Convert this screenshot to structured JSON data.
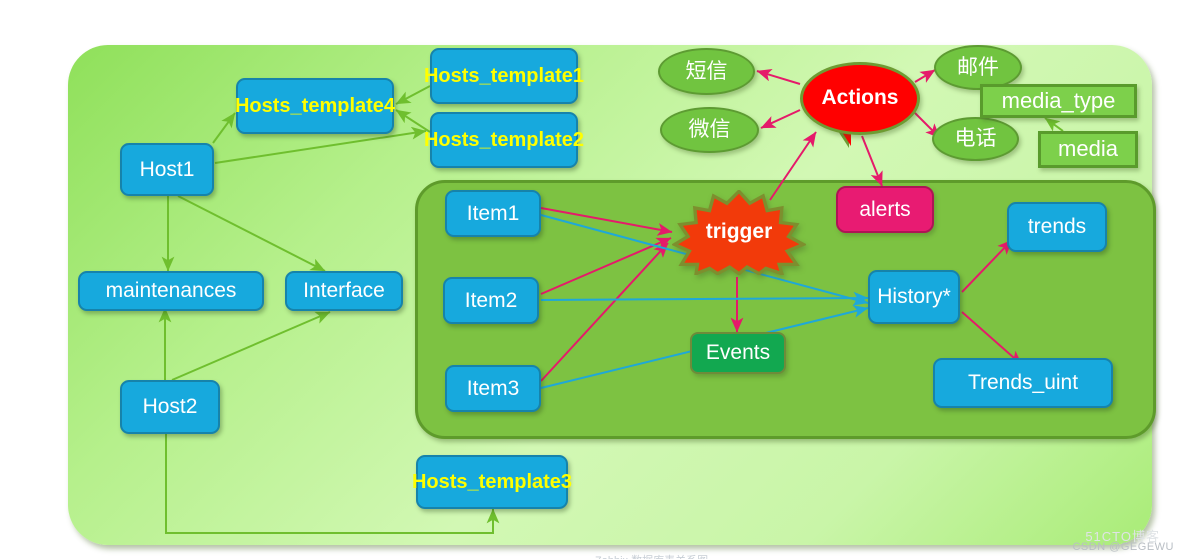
{
  "diagram": {
    "title": "Zabbix data model relationship diagram",
    "colors": {
      "blue_node": "#17a9dd",
      "blue_border": "#1683ab",
      "template_text": "#ffff00",
      "outer_panel": "#b6f08c",
      "inner_panel": "#7dc242",
      "actions_red": "#ff0000",
      "trigger_orange": "#f23a0a",
      "alerts_magenta": "#e81b72",
      "events_green": "#12a850",
      "media_green": "#7dd04b",
      "green_arrow": "#6fbf2e",
      "pink_arrow": "#e51a6a",
      "cyan_arrow": "#1fa8d8"
    },
    "nodes": {
      "host1": "Host1",
      "host2": "Host2",
      "maintenances": "maintenances",
      "interface": "Interface",
      "hosts_template4": "Hosts_template4",
      "hosts_template1": "Hosts_template1",
      "hosts_template2": "Hosts_template2",
      "hosts_template3": "Hosts_template3",
      "item1": "Item1",
      "item2": "Item2",
      "item3": "Item3",
      "trigger": "trigger",
      "actions": "Actions",
      "alerts": "alerts",
      "events": "Events",
      "history": "History*",
      "trends": "trends",
      "trends_uint": "Trends_uint",
      "sms": "短信",
      "wechat": "微信",
      "email": "邮件",
      "phone": "电话",
      "media_type": "media_type",
      "media": "media"
    },
    "watermark": {
      "csdn": "CSDN @GEGEWU",
      "overlay": "51CTO博客",
      "bottom_faint": "Zabbix 数据库表关系图"
    }
  }
}
